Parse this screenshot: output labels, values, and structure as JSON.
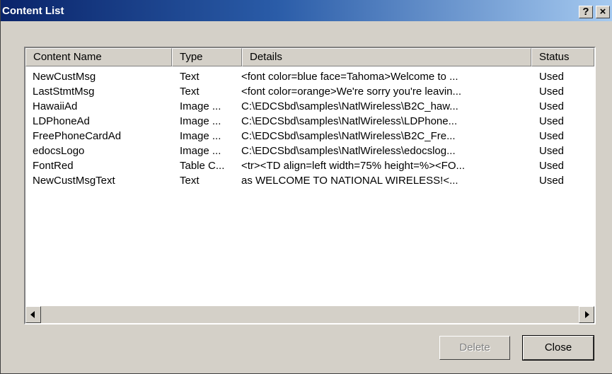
{
  "window": {
    "title": "Content List"
  },
  "titlebar": {
    "help_label": "?",
    "close_label": "×"
  },
  "list": {
    "columns": [
      "Content Name",
      "Type",
      "Details",
      "Status"
    ],
    "rows": [
      [
        "NewCustMsg",
        "Text",
        "<font color=blue face=Tahoma>Welcome to ...",
        "Used"
      ],
      [
        "LastStmtMsg",
        "Text",
        "<font color=orange>We're sorry you're leavin...",
        "Used"
      ],
      [
        "HawaiiAd",
        "Image ...",
        "C:\\EDCSbd\\samples\\NatlWireless\\B2C_haw...",
        "Used"
      ],
      [
        "LDPhoneAd",
        "Image ...",
        "C:\\EDCSbd\\samples\\NatlWireless\\LDPhone...",
        "Used"
      ],
      [
        "FreePhoneCardAd",
        "Image ...",
        "C:\\EDCSbd\\samples\\NatlWireless\\B2C_Fre...",
        "Used"
      ],
      [
        "edocsLogo",
        "Image ...",
        "C:\\EDCSbd\\samples\\NatlWireless\\edocslog...",
        "Used"
      ],
      [
        "FontRed",
        "Table C...",
        "<tr><TD align=left width=75% height=%><FO...",
        "Used"
      ],
      [
        "NewCustMsgText",
        "Text",
        "as WELCOME TO NATIONAL WIRELESS!<...",
        "Used"
      ]
    ]
  },
  "buttons": {
    "delete_label": "Delete",
    "close_label": "Close"
  },
  "icons": {
    "scroll_left": "chevron-left-icon",
    "scroll_right": "chevron-right-icon"
  }
}
